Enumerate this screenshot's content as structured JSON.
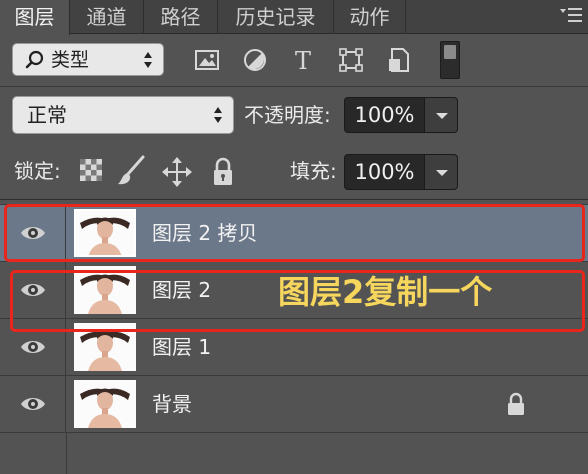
{
  "tabs": [
    {
      "label": "图层",
      "active": true
    },
    {
      "label": "通道",
      "active": false
    },
    {
      "label": "路径",
      "active": false
    },
    {
      "label": "历史记录",
      "active": false
    },
    {
      "label": "动作",
      "active": false
    }
  ],
  "filter": {
    "kind_label": "类型",
    "icons": [
      "image-filter-icon",
      "adjustment-filter-icon",
      "type-filter-icon",
      "shape-filter-icon",
      "smart-object-filter-icon",
      "filter-toggle-icon"
    ]
  },
  "blend": {
    "mode": "正常",
    "opacity_label": "不透明度:",
    "opacity_value": "100%"
  },
  "lock": {
    "label": "锁定:",
    "fill_label": "填充:",
    "fill_value": "100%",
    "icons": [
      "lock-transparent-icon",
      "lock-image-icon",
      "lock-position-icon",
      "lock-all-icon"
    ]
  },
  "layers": [
    {
      "name": "图层 2 拷贝",
      "selected": true,
      "visible": true,
      "locked": false
    },
    {
      "name": "图层 2",
      "selected": false,
      "visible": true,
      "locked": false
    },
    {
      "name": "图层 1",
      "selected": false,
      "visible": true,
      "locked": false
    },
    {
      "name": "背景",
      "selected": false,
      "visible": true,
      "locked": true
    }
  ],
  "annotation": "图层2复制一个",
  "colors": {
    "panel_bg": "#535353",
    "selected_row": "#6b7889",
    "highlight": "#e8261b",
    "annotation_text": "#f6d65c"
  }
}
